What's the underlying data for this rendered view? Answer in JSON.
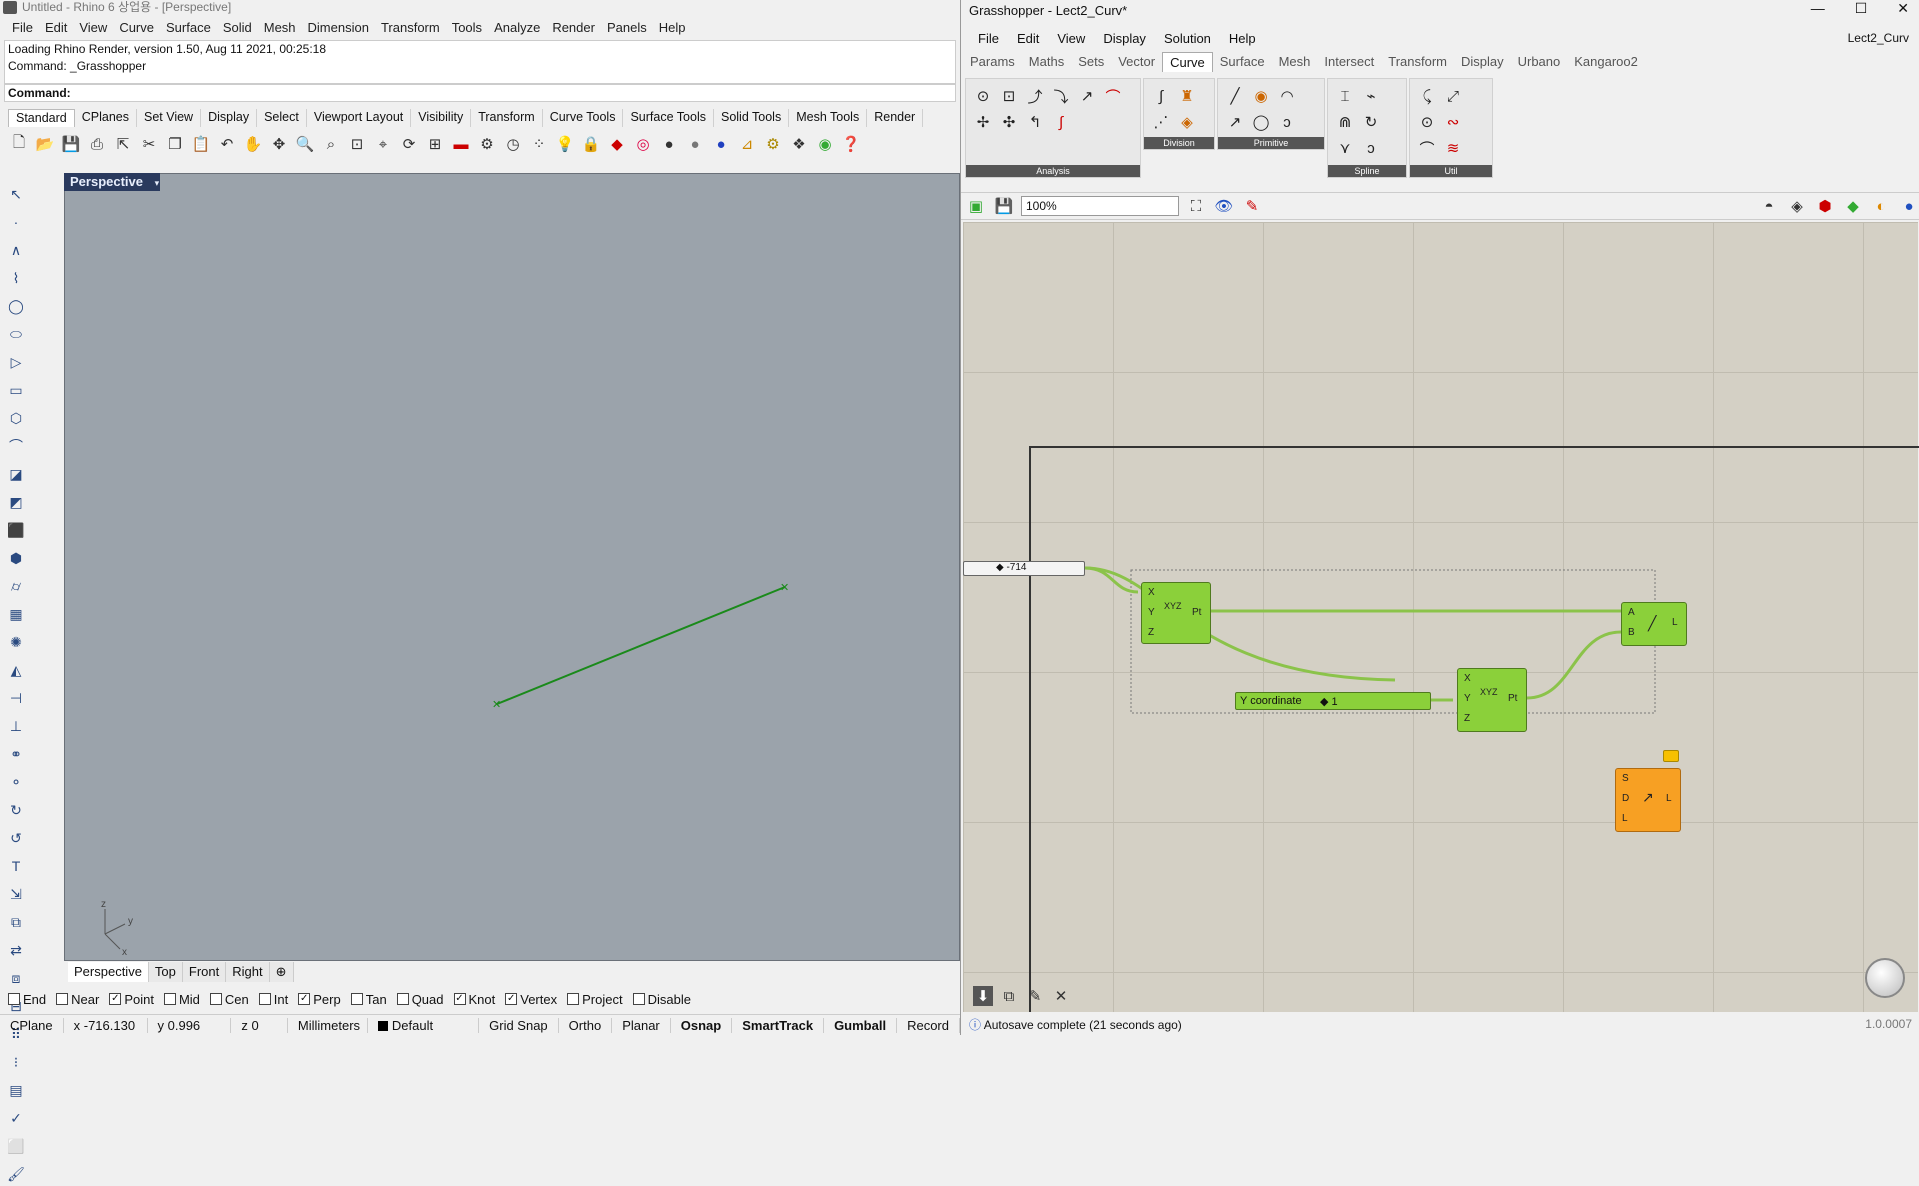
{
  "rhino": {
    "title": "Untitled - Rhino 6 상업용 - [Perspective]",
    "menu": [
      "File",
      "Edit",
      "View",
      "Curve",
      "Surface",
      "Solid",
      "Mesh",
      "Dimension",
      "Transform",
      "Tools",
      "Analyze",
      "Render",
      "Panels",
      "Help"
    ],
    "history": [
      "Loading Rhino Render, version 1.50, Aug 11 2021, 00:25:18",
      "Command: _Grasshopper"
    ],
    "command_label": "Command:",
    "toolbar_tabs": [
      "Standard",
      "CPlanes",
      "Set View",
      "Display",
      "Select",
      "Viewport Layout",
      "Visibility",
      "Transform",
      "Curve Tools",
      "Surface Tools",
      "Solid Tools",
      "Mesh Tools",
      "Render"
    ],
    "viewport_label": "Perspective",
    "viewport_tabs": [
      "Perspective",
      "Top",
      "Front",
      "Right",
      "⊕"
    ],
    "axis": {
      "z": "z",
      "y": "y",
      "x": "x"
    },
    "osnaps": [
      {
        "label": "End",
        "checked": false
      },
      {
        "label": "Near",
        "checked": false
      },
      {
        "label": "Point",
        "checked": true
      },
      {
        "label": "Mid",
        "checked": false
      },
      {
        "label": "Cen",
        "checked": false
      },
      {
        "label": "Int",
        "checked": false
      },
      {
        "label": "Perp",
        "checked": true
      },
      {
        "label": "Tan",
        "checked": false
      },
      {
        "label": "Quad",
        "checked": false
      },
      {
        "label": "Knot",
        "checked": true
      },
      {
        "label": "Vertex",
        "checked": true
      },
      {
        "label": "Project",
        "checked": false
      },
      {
        "label": "Disable",
        "checked": false
      }
    ],
    "status": {
      "cplane": "CPlane",
      "x": "x -716.130",
      "y": "y 0.996",
      "z": "z 0",
      "units": "Millimeters",
      "layer": "Default",
      "grid_snap": "Grid Snap",
      "ortho": "Ortho",
      "planar": "Planar",
      "osnap": "Osnap",
      "smarttrack": "SmartTrack",
      "gumball": "Gumball",
      "record": "Record"
    },
    "line_color": "#1a8a1a"
  },
  "gh": {
    "title": "Grasshopper - Lect2_Curv*",
    "doc_name": "Lect2_Curv",
    "menu": [
      "File",
      "Edit",
      "View",
      "Display",
      "Solution",
      "Help"
    ],
    "tabs": [
      "Params",
      "Maths",
      "Sets",
      "Vector",
      "Curve",
      "Surface",
      "Mesh",
      "Intersect",
      "Transform",
      "Display",
      "Urbano",
      "Kangaroo2"
    ],
    "active_tab": "Curve",
    "groups": [
      "Analysis",
      "Division",
      "Primitive",
      "Spline",
      "Util"
    ],
    "zoom": "100%",
    "number_slider_value": "◆ -714",
    "y_slider_label": "Y coordinate",
    "y_slider_value": "◆ 1",
    "pt1_ports_in": [
      "X",
      "Y",
      "Z"
    ],
    "pt_label": "Pt",
    "xyz_label": "XYZ",
    "line_ports_in": [
      "A",
      "B"
    ],
    "line_port_out": "L",
    "sdl_ports_in": [
      "S",
      "D",
      "L"
    ],
    "autosave": "Autosave complete (21 seconds ago)",
    "version": "1.0.0007"
  }
}
